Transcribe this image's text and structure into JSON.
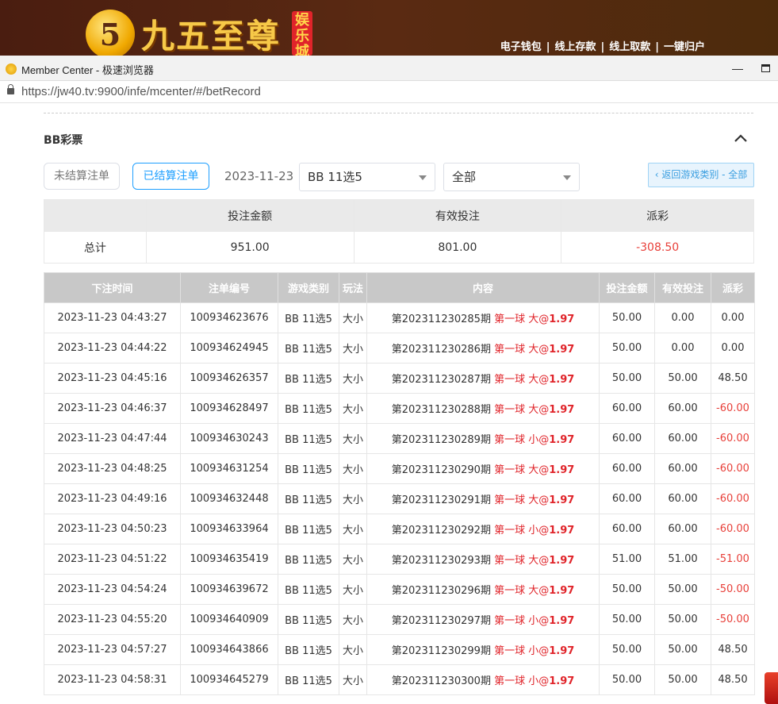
{
  "site": {
    "logo_numeral": "5",
    "logo_text": "九五至尊",
    "logo_badge": "娱乐城",
    "nav": [
      "电子钱包",
      "线上存款",
      "线上取款",
      "一键归户"
    ]
  },
  "browser": {
    "title": "Member Center - 极速浏览器",
    "min_symbol": "—",
    "url": "https://jw40.tv:9900/infe/mcenter/#/betRecord"
  },
  "page": {
    "section_title": "BB彩票",
    "filters": {
      "unsettled_label": "未结算注单",
      "settled_label": "已结算注单",
      "date": "2023-11-23",
      "game_select": "BB 11选5",
      "type_select": "全部",
      "back_label": "‹ 返回游戏类别 - 全部"
    },
    "summary": {
      "headers": [
        "投注金额",
        "有效投注",
        "派彩"
      ],
      "row_label": "总计",
      "bet_amount": "951.00",
      "valid_bet": "801.00",
      "payout": "-308.50"
    },
    "table": {
      "headers": [
        "下注时间",
        "注单编号",
        "游戏类别",
        "玩法",
        "内容",
        "投注金额",
        "有效投注",
        "派彩"
      ],
      "rows": [
        {
          "time": "2023-11-23 04:43:27",
          "id": "100934623676",
          "game": "BB 11选5",
          "play": "大小",
          "period": "第202311230285期",
          "pick": "第一球 大",
          "odds": "1.97",
          "bet": "50.00",
          "valid": "0.00",
          "payout": "0.00",
          "neg": false
        },
        {
          "time": "2023-11-23 04:44:22",
          "id": "100934624945",
          "game": "BB 11选5",
          "play": "大小",
          "period": "第202311230286期",
          "pick": "第一球 大",
          "odds": "1.97",
          "bet": "50.00",
          "valid": "0.00",
          "payout": "0.00",
          "neg": false
        },
        {
          "time": "2023-11-23 04:45:16",
          "id": "100934626357",
          "game": "BB 11选5",
          "play": "大小",
          "period": "第202311230287期",
          "pick": "第一球 大",
          "odds": "1.97",
          "bet": "50.00",
          "valid": "50.00",
          "payout": "48.50",
          "neg": false
        },
        {
          "time": "2023-11-23 04:46:37",
          "id": "100934628497",
          "game": "BB 11选5",
          "play": "大小",
          "period": "第202311230288期",
          "pick": "第一球 大",
          "odds": "1.97",
          "bet": "60.00",
          "valid": "60.00",
          "payout": "-60.00",
          "neg": true
        },
        {
          "time": "2023-11-23 04:47:44",
          "id": "100934630243",
          "game": "BB 11选5",
          "play": "大小",
          "period": "第202311230289期",
          "pick": "第一球 小",
          "odds": "1.97",
          "bet": "60.00",
          "valid": "60.00",
          "payout": "-60.00",
          "neg": true
        },
        {
          "time": "2023-11-23 04:48:25",
          "id": "100934631254",
          "game": "BB 11选5",
          "play": "大小",
          "period": "第202311230290期",
          "pick": "第一球 大",
          "odds": "1.97",
          "bet": "60.00",
          "valid": "60.00",
          "payout": "-60.00",
          "neg": true
        },
        {
          "time": "2023-11-23 04:49:16",
          "id": "100934632448",
          "game": "BB 11选5",
          "play": "大小",
          "period": "第202311230291期",
          "pick": "第一球 大",
          "odds": "1.97",
          "bet": "60.00",
          "valid": "60.00",
          "payout": "-60.00",
          "neg": true
        },
        {
          "time": "2023-11-23 04:50:23",
          "id": "100934633964",
          "game": "BB 11选5",
          "play": "大小",
          "period": "第202311230292期",
          "pick": "第一球 小",
          "odds": "1.97",
          "bet": "60.00",
          "valid": "60.00",
          "payout": "-60.00",
          "neg": true
        },
        {
          "time": "2023-11-23 04:51:22",
          "id": "100934635419",
          "game": "BB 11选5",
          "play": "大小",
          "period": "第202311230293期",
          "pick": "第一球 大",
          "odds": "1.97",
          "bet": "51.00",
          "valid": "51.00",
          "payout": "-51.00",
          "neg": true
        },
        {
          "time": "2023-11-23 04:54:24",
          "id": "100934639672",
          "game": "BB 11选5",
          "play": "大小",
          "period": "第202311230296期",
          "pick": "第一球 大",
          "odds": "1.97",
          "bet": "50.00",
          "valid": "50.00",
          "payout": "-50.00",
          "neg": true
        },
        {
          "time": "2023-11-23 04:55:20",
          "id": "100934640909",
          "game": "BB 11选5",
          "play": "大小",
          "period": "第202311230297期",
          "pick": "第一球 小",
          "odds": "1.97",
          "bet": "50.00",
          "valid": "50.00",
          "payout": "-50.00",
          "neg": true
        },
        {
          "time": "2023-11-23 04:57:27",
          "id": "100934643866",
          "game": "BB 11选5",
          "play": "大小",
          "period": "第202311230299期",
          "pick": "第一球 小",
          "odds": "1.97",
          "bet": "50.00",
          "valid": "50.00",
          "payout": "48.50",
          "neg": false
        },
        {
          "time": "2023-11-23 04:58:31",
          "id": "100934645279",
          "game": "BB 11选5",
          "play": "大小",
          "period": "第202311230300期",
          "pick": "第一球 小",
          "odds": "1.97",
          "bet": "50.00",
          "valid": "50.00",
          "payout": "48.50",
          "neg": false
        }
      ]
    }
  },
  "colors": {
    "accent_blue": "#1e9fff",
    "negative_red": "#e8403a",
    "header_gray": "#c8c8c8"
  }
}
